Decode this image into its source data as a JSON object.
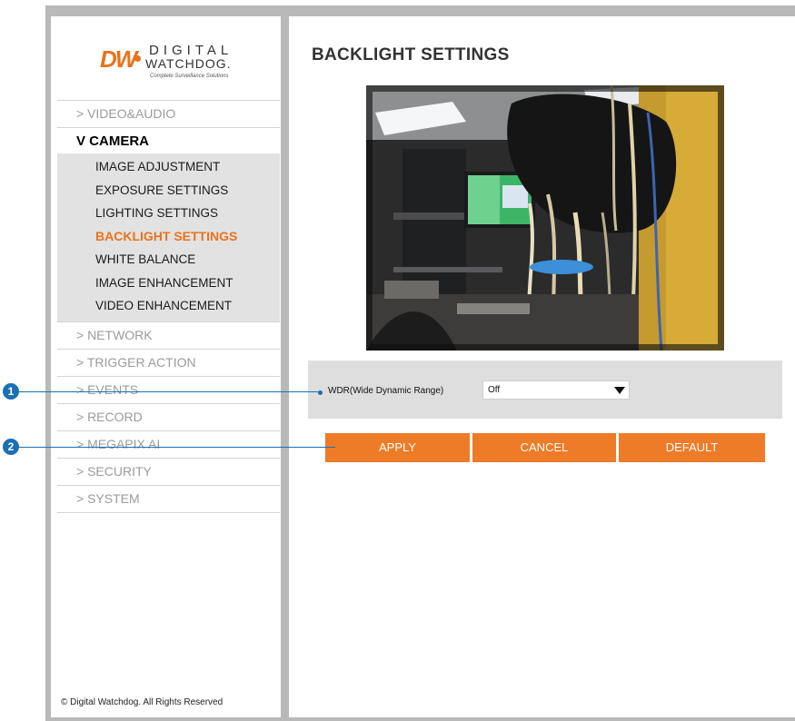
{
  "logo": {
    "brand_mark": "DW",
    "word1": "DIGITAL",
    "word2": "WATCHDOG.",
    "tagline": "Complete Surveillance Solutions"
  },
  "sidebar": {
    "items": [
      {
        "label": "> VIDEO&AUDIO"
      },
      {
        "label": "V CAMERA",
        "expanded": true
      },
      {
        "label": "> NETWORK"
      },
      {
        "label": "> TRIGGER ACTION"
      },
      {
        "label": "> EVENTS"
      },
      {
        "label": "> RECORD"
      },
      {
        "label": "> MEGAPIX AI"
      },
      {
        "label": "> SECURITY"
      },
      {
        "label": "> SYSTEM"
      }
    ],
    "camera_submenu": [
      {
        "label": "IMAGE ADJUSTMENT"
      },
      {
        "label": "EXPOSURE SETTINGS"
      },
      {
        "label": "LIGHTING SETTINGS"
      },
      {
        "label": "BACKLIGHT SETTINGS",
        "active": true
      },
      {
        "label": "WHITE BALANCE"
      },
      {
        "label": "IMAGE ENHANCEMENT"
      },
      {
        "label": "VIDEO ENHANCEMENT"
      }
    ],
    "copyright": "© Digital Watchdog. All Rights Reserved"
  },
  "main": {
    "title": "BACKLIGHT SETTINGS",
    "wdr": {
      "label": "WDR(Wide Dynamic Range)",
      "value": "Off"
    },
    "buttons": {
      "apply": "APPLY",
      "cancel": "CANCEL",
      "default": "DEFAULT"
    }
  },
  "callouts": {
    "one": "1",
    "two": "2"
  },
  "colors": {
    "accent": "#ee7b27",
    "active_menu": "#e8731c",
    "callout": "#1a6fb5",
    "frame": "#b9b9b9"
  }
}
